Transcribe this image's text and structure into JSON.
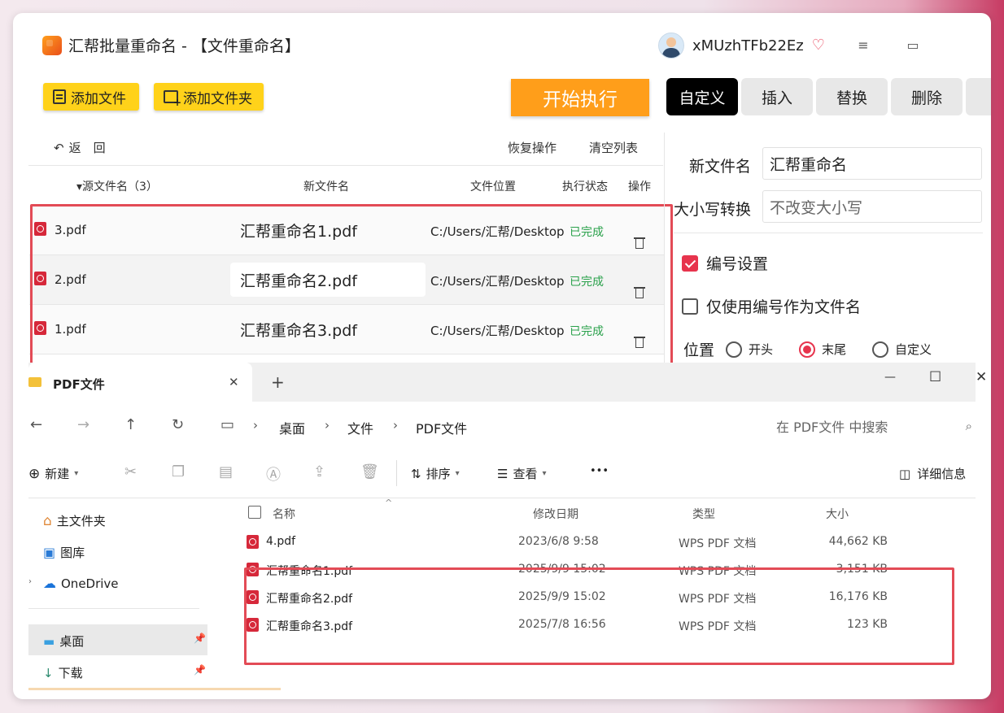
{
  "app": {
    "title": "汇帮批量重命名 - 【文件重命名】",
    "username": "xMUzhTFb22Ez",
    "menu_icon": "≡",
    "window_icon": "▭"
  },
  "toolbar": {
    "add_file": "添加文件",
    "add_folder": "添加文件夹",
    "start": "开始执行",
    "undo": "返　回",
    "restore": "恢复操作",
    "clear": "清空列表"
  },
  "tabs": [
    "自定义",
    "插入",
    "替换",
    "删除"
  ],
  "table": {
    "headers": {
      "source": "▾源文件名（3）",
      "new": "新文件名",
      "location": "文件位置",
      "status": "执行状态",
      "action": "操作"
    },
    "rows": [
      {
        "source": "3.pdf",
        "new": "汇帮重命名1.pdf",
        "location": "C:/Users/汇帮/Desktop",
        "status": "已完成"
      },
      {
        "source": "2.pdf",
        "new": "汇帮重命名2.pdf",
        "location": "C:/Users/汇帮/Desktop",
        "status": "已完成"
      },
      {
        "source": "1.pdf",
        "new": "汇帮重命名3.pdf",
        "location": "C:/Users/汇帮/Desktop",
        "status": "已完成"
      }
    ]
  },
  "settings": {
    "new_name_label": "新文件名",
    "new_name_value": "汇帮重命名",
    "case_label": "大小写转换",
    "case_value": "不改变大小写",
    "numbering": "编号设置",
    "numbering_only": "仅使用编号作为文件名",
    "position_label": "位置",
    "position_options": [
      "开头",
      "末尾",
      "自定义"
    ]
  },
  "explorer": {
    "tab_title": "PDF文件",
    "tab_close": "✕",
    "tab_add": "+",
    "min": "—",
    "max": "☐",
    "close": "✕",
    "breadcrumb": [
      "桌面",
      "文件",
      "PDF文件"
    ],
    "search_placeholder": "在 PDF文件 中搜索",
    "cmd": {
      "new": "新建",
      "sort": "排序",
      "view": "查看",
      "more": "•••",
      "details": "详细信息"
    },
    "sidebar": [
      "主文件夹",
      "图库",
      "OneDrive",
      "桌面",
      "下载"
    ],
    "columns": {
      "name": "名称",
      "date": "修改日期",
      "type": "类型",
      "size": "大小"
    },
    "files": [
      {
        "name": "4.pdf",
        "date": "2023/6/8 9:58",
        "type": "WPS PDF 文档",
        "size": "44,662 KB"
      },
      {
        "name": "汇帮重命名1.pdf",
        "date": "2025/9/9 15:02",
        "type": "WPS PDF 文档",
        "size": "3,151 KB"
      },
      {
        "name": "汇帮重命名2.pdf",
        "date": "2025/9/9 15:02",
        "type": "WPS PDF 文档",
        "size": "16,176 KB"
      },
      {
        "name": "汇帮重命名3.pdf",
        "date": "2025/7/8 16:56",
        "type": "WPS PDF 文档",
        "size": "123 KB"
      }
    ]
  }
}
